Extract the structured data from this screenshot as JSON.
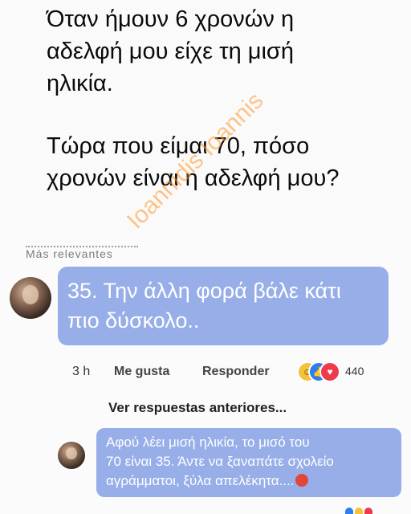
{
  "post": {
    "paragraph1": "Όταν ήμουν 6 χρονών η\nαδελφή μου είχε τη μισή\nηλικία.",
    "paragraph2": "Τώρα που είμαι 70, πόσο\nχρονών είναι η αδελφή μου?"
  },
  "comments": {
    "header_fragment": "Más relevantes",
    "first": {
      "text": "35. Την άλλη φορά βάλε κάτι πιο δύσκολο..",
      "time": "3 h",
      "like_label": "Me gusta",
      "reply_label": "Responder",
      "reactions": [
        "haha-icon",
        "like-icon",
        "love-icon"
      ],
      "reaction_count": "440"
    },
    "view_previous": "Ver respuestas anteriores...",
    "reply": {
      "text": "Αφού λέει μισή ηλικία, το μισό του\n70 είναι 35. Άντε να ξαναπάτε σχολείο\nαγράμματοι, ξύλα απελέκητα....",
      "emoji": "angry-face-icon"
    }
  },
  "watermark": "Ioannidis Ioannis",
  "side_id": "144528",
  "colors": {
    "bubble": "#97aee8",
    "watermark": "#f08a28"
  }
}
